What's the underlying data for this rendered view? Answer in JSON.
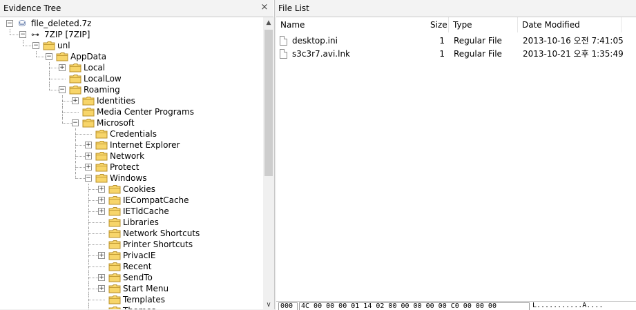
{
  "tree_panel": {
    "title": "Evidence Tree",
    "close_glyph": "×",
    "nodes": [
      {
        "label": "file_deleted.7z",
        "depth": 0,
        "expander": "−",
        "icon": "evidence-file-icon"
      },
      {
        "label": "7ZIP [7ZIP]",
        "depth": 1,
        "expander": "−",
        "icon": "volume-icon"
      },
      {
        "label": "unl",
        "depth": 2,
        "expander": "−",
        "icon": "folder-icon"
      },
      {
        "label": "AppData",
        "depth": 3,
        "expander": "−",
        "icon": "folder-icon"
      },
      {
        "label": "Local",
        "depth": 4,
        "expander": "+",
        "icon": "folder-icon"
      },
      {
        "label": "LocalLow",
        "depth": 4,
        "expander": "",
        "icon": "folder-icon"
      },
      {
        "label": "Roaming",
        "depth": 4,
        "expander": "−",
        "icon": "folder-icon"
      },
      {
        "label": "Identities",
        "depth": 5,
        "expander": "+",
        "icon": "folder-icon"
      },
      {
        "label": "Media Center Programs",
        "depth": 5,
        "expander": "",
        "icon": "folder-icon"
      },
      {
        "label": "Microsoft",
        "depth": 5,
        "expander": "−",
        "icon": "folder-icon"
      },
      {
        "label": "Credentials",
        "depth": 6,
        "expander": "",
        "icon": "folder-icon"
      },
      {
        "label": "Internet Explorer",
        "depth": 6,
        "expander": "+",
        "icon": "folder-icon"
      },
      {
        "label": "Network",
        "depth": 6,
        "expander": "+",
        "icon": "folder-icon"
      },
      {
        "label": "Protect",
        "depth": 6,
        "expander": "+",
        "icon": "folder-icon"
      },
      {
        "label": "Windows",
        "depth": 6,
        "expander": "−",
        "icon": "folder-icon"
      },
      {
        "label": "Cookies",
        "depth": 7,
        "expander": "+",
        "icon": "folder-icon"
      },
      {
        "label": "IECompatCache",
        "depth": 7,
        "expander": "+",
        "icon": "folder-icon"
      },
      {
        "label": "IETldCache",
        "depth": 7,
        "expander": "+",
        "icon": "folder-icon"
      },
      {
        "label": "Libraries",
        "depth": 7,
        "expander": "",
        "icon": "folder-icon"
      },
      {
        "label": "Network Shortcuts",
        "depth": 7,
        "expander": "",
        "icon": "folder-icon"
      },
      {
        "label": "Printer Shortcuts",
        "depth": 7,
        "expander": "",
        "icon": "folder-icon"
      },
      {
        "label": "PrivacIE",
        "depth": 7,
        "expander": "+",
        "icon": "folder-icon"
      },
      {
        "label": "Recent",
        "depth": 7,
        "expander": "",
        "icon": "folder-icon"
      },
      {
        "label": "SendTo",
        "depth": 7,
        "expander": "+",
        "icon": "folder-icon"
      },
      {
        "label": "Start Menu",
        "depth": 7,
        "expander": "+",
        "icon": "folder-icon"
      },
      {
        "label": "Templates",
        "depth": 7,
        "expander": "",
        "icon": "folder-icon"
      },
      {
        "label": "Themes",
        "depth": 7,
        "expander": "",
        "icon": "folder-icon"
      }
    ]
  },
  "file_list": {
    "title": "File List",
    "columns": [
      "Name",
      "Size",
      "Type",
      "Date Modified"
    ],
    "rows": [
      {
        "name": "desktop.ini",
        "size": "1",
        "type": "Regular File",
        "modified": "2013-10-16 오전 7:41:05"
      },
      {
        "name": "s3c3r7.avi.lnk",
        "size": "1",
        "type": "Regular File",
        "modified": "2013-10-21 오후 1:35:49"
      }
    ]
  },
  "hex_view": {
    "offset": "000",
    "bytes": "4C 00 00 00 01 14 02 00 00 00 00 00 C0 00 00 00",
    "ascii": "L...........À...."
  },
  "colors": {
    "folder_fill": "#f7d56a",
    "folder_stroke": "#b8902a",
    "panel_header": "#f3f3f3"
  }
}
